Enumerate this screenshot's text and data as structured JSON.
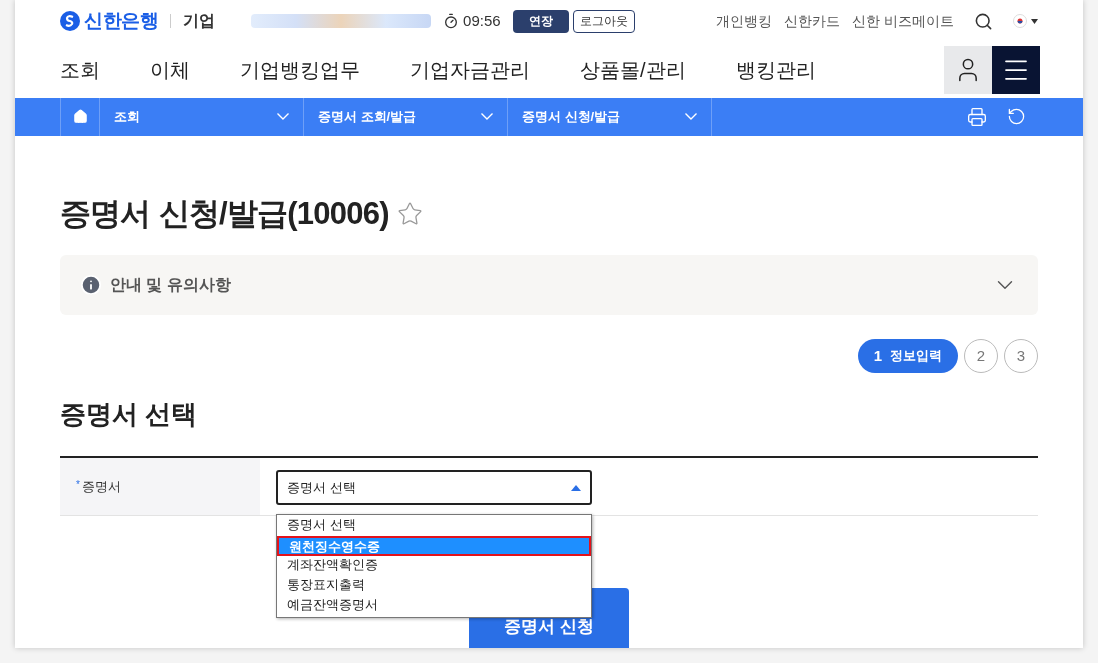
{
  "header": {
    "logo": "신한은행",
    "segment": "기업",
    "time": "09:56",
    "extend_button": "연장",
    "logout_button": "로그아웃",
    "links": [
      "개인뱅킹",
      "신한카드",
      "신한 비즈메이트"
    ]
  },
  "nav": {
    "items": [
      "조회",
      "이체",
      "기업뱅킹업무",
      "기업자금관리",
      "상품몰/관리",
      "뱅킹관리"
    ]
  },
  "breadcrumb": [
    "조회",
    "증명서 조회/발급",
    "증명서 신청/발급"
  ],
  "page": {
    "title": "증명서 신청/발급(10006)",
    "starred": false,
    "notice": {
      "label": "안내 및 유의사항",
      "expanded": false
    }
  },
  "steps": [
    {
      "number": "1",
      "label": "정보입력",
      "selected": true
    },
    {
      "number": "2",
      "selected": false
    },
    {
      "number": "3",
      "selected": false
    }
  ],
  "section_title": "증명서 선택",
  "form": {
    "label": "증명서",
    "required_mark": "*",
    "select_value": "증명서 선택",
    "options": [
      {
        "label": "증명서 선택",
        "selected": false
      },
      {
        "label": "원천징수영수증",
        "selected": true
      },
      {
        "label": "계좌잔액확인증",
        "selected": false
      },
      {
        "label": "통장표지출력",
        "selected": false
      },
      {
        "label": "예금잔액증명서",
        "selected": false
      }
    ]
  },
  "submit_button": "증명서 신청"
}
